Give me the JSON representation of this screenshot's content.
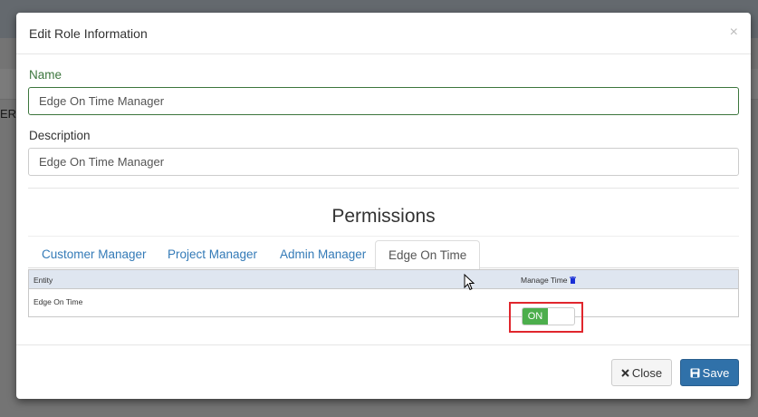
{
  "background": {
    "partial_text": "ER"
  },
  "modal": {
    "title": "Edit Role Information",
    "close_glyph": "×"
  },
  "form": {
    "name": {
      "label": "Name",
      "value": "Edge On Time Manager"
    },
    "description": {
      "label": "Description",
      "value": "Edge On Time Manager"
    }
  },
  "permissions": {
    "title": "Permissions",
    "tabs": [
      {
        "label": "Customer Manager",
        "active": false
      },
      {
        "label": "Project Manager",
        "active": false
      },
      {
        "label": "Admin Manager",
        "active": false
      },
      {
        "label": "Edge On Time",
        "active": true
      }
    ],
    "grid": {
      "columns": [
        "Entity",
        "Manage Time"
      ],
      "rows": [
        {
          "entity": "Edge On Time",
          "manage_time": "ON"
        }
      ]
    }
  },
  "footer": {
    "close_label": "Close",
    "save_label": "Save"
  },
  "colors": {
    "primary": "#3071a9",
    "success": "#4cae4c",
    "highlight": "#e0262d",
    "valid": "#3c763d"
  }
}
